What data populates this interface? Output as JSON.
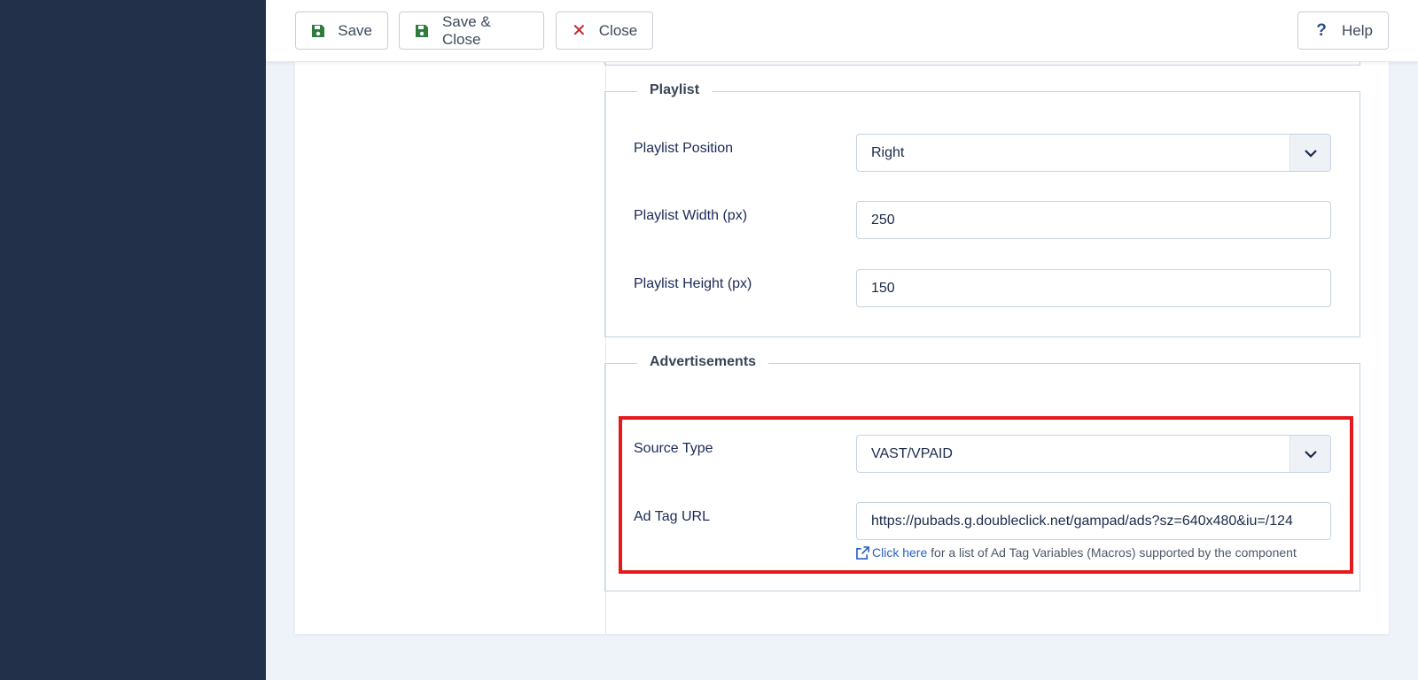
{
  "toolbar": {
    "save_label": "Save",
    "save_close_label": "Save & Close",
    "close_label": "Close",
    "help_label": "Help"
  },
  "playlist": {
    "legend": "Playlist",
    "position": {
      "label": "Playlist Position",
      "value": "Right"
    },
    "width": {
      "label": "Playlist Width (px)",
      "value": "250"
    },
    "height": {
      "label": "Playlist Height (px)",
      "value": "150"
    }
  },
  "ads": {
    "legend": "Advertisements",
    "source_type": {
      "label": "Source Type",
      "value": "VAST/VPAID"
    },
    "ad_tag_url": {
      "label": "Ad Tag URL",
      "value": "https://pubads.g.doubleclick.net/gampad/ads?sz=640x480&iu=/124"
    },
    "hint_link": "Click here",
    "hint_text": " for a list of Ad Tag Variables (Macros) supported by the component"
  },
  "colors": {
    "sidebar": "#22304a",
    "highlight": "#e51b1b",
    "link": "#2a62c4",
    "save_icon": "#2f7a3f",
    "close_icon": "#c0262d"
  }
}
